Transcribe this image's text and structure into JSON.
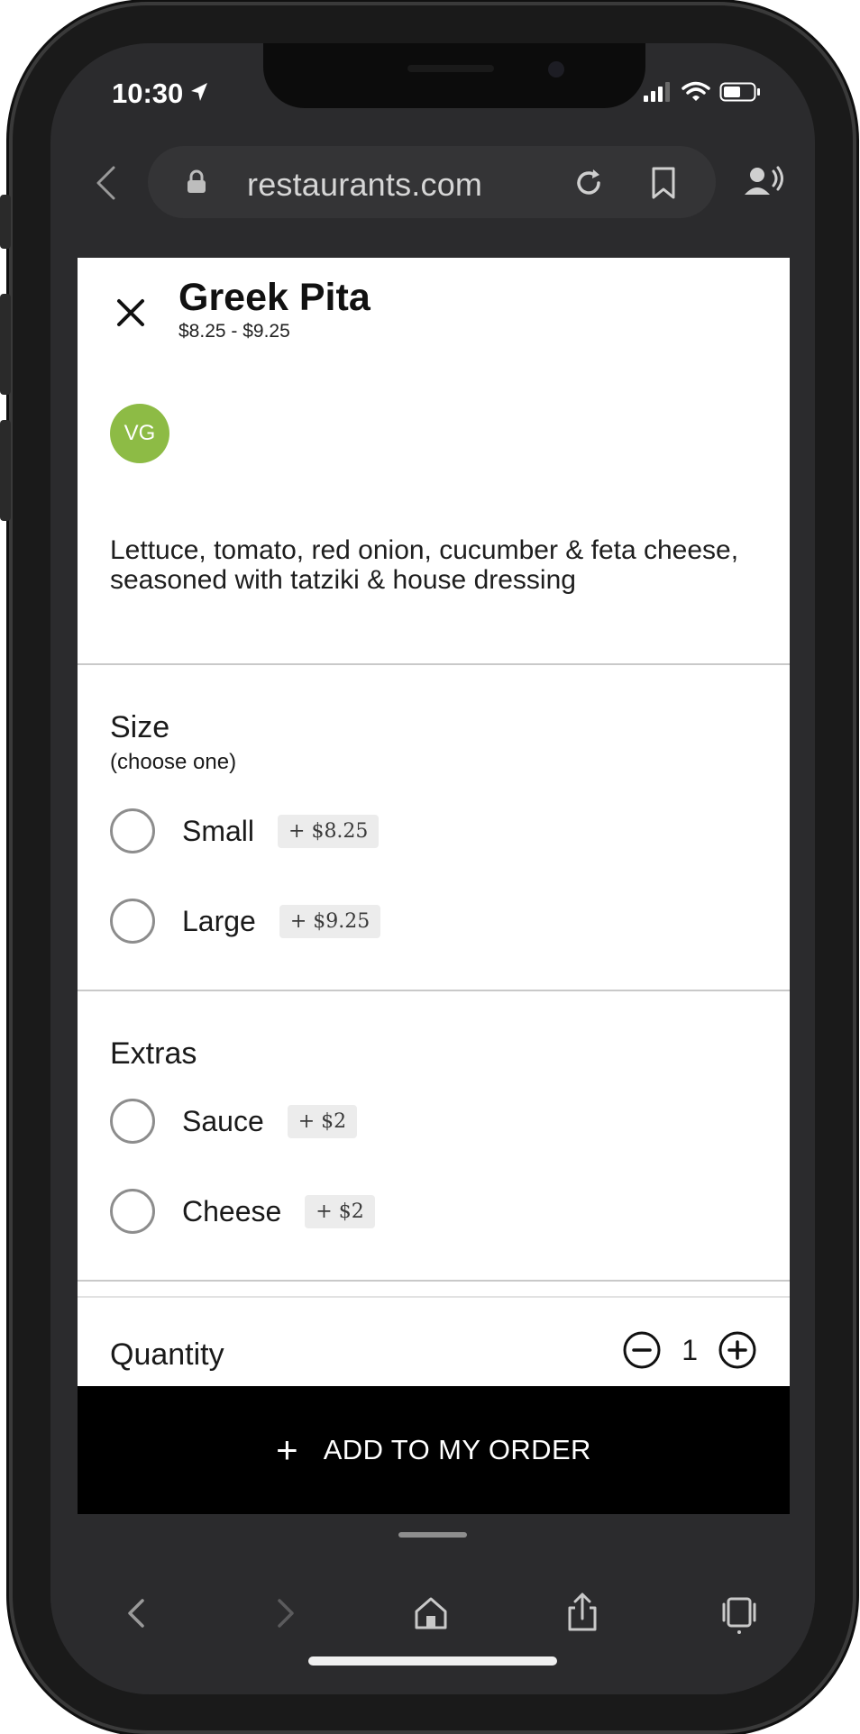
{
  "status_bar": {
    "time": "10:30",
    "icons": [
      "location-arrow-icon",
      "signal-icon",
      "wifi-icon",
      "battery-icon"
    ]
  },
  "browser": {
    "url": "restaurants.com",
    "icons": [
      "back-icon",
      "lock-icon",
      "reload-icon",
      "bookmark-icon",
      "reader-voice-icon"
    ]
  },
  "item": {
    "title": "Greek Pita",
    "price_range": "$8.25 - $9.25",
    "badge": "VG",
    "description": "Lettuce, tomato, red onion, cucumber & feta cheese, seasoned with tatziki & house dressing"
  },
  "size_section": {
    "title": "Size",
    "subtitle": "(choose one)",
    "options": [
      {
        "label": "Small",
        "price": "+ $8.25"
      },
      {
        "label": "Large",
        "price": "+ $9.25"
      }
    ]
  },
  "extras_section": {
    "title": "Extras",
    "options": [
      {
        "label": "Sauce",
        "price": "+ $2"
      },
      {
        "label": "Cheese",
        "price": "+ $2"
      }
    ]
  },
  "quantity": {
    "label": "Quantity",
    "value": "1"
  },
  "add_button": {
    "plus": "+",
    "label": "ADD TO MY ORDER"
  },
  "toolbar": {
    "icons": [
      "back-icon",
      "forward-icon",
      "home-icon",
      "share-icon",
      "tabs-icon"
    ]
  },
  "colors": {
    "badge_green": "#8dbb45",
    "add_bar": "#000000",
    "browser_chrome": "#2b2b2d"
  }
}
